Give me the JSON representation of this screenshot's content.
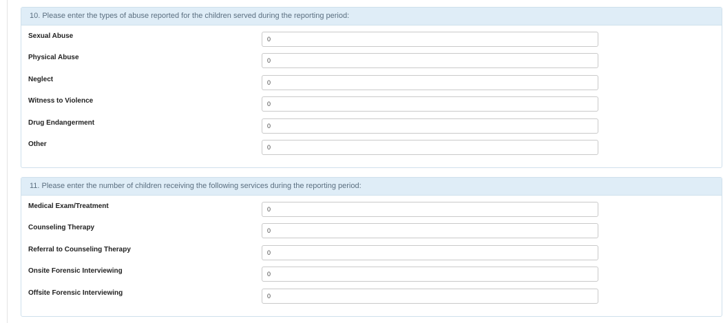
{
  "sections": [
    {
      "heading": "10. Please enter the types of abuse reported for the children served during the reporting period:",
      "rows": [
        {
          "label": "Sexual Abuse",
          "value": "0"
        },
        {
          "label": "Physical Abuse",
          "value": "0"
        },
        {
          "label": "Neglect",
          "value": "0"
        },
        {
          "label": "Witness to Violence",
          "value": "0"
        },
        {
          "label": "Drug Endangerment",
          "value": "0"
        },
        {
          "label": "Other",
          "value": "0"
        }
      ]
    },
    {
      "heading": "11. Please enter the number of children receiving the following services during the reporting period:",
      "rows": [
        {
          "label": "Medical Exam/Treatment",
          "value": "0"
        },
        {
          "label": "Counseling Therapy",
          "value": "0"
        },
        {
          "label": "Referral to Counseling Therapy",
          "value": "0"
        },
        {
          "label": "Onsite Forensic Interviewing",
          "value": "0"
        },
        {
          "label": "Offsite Forensic Interviewing",
          "value": "0"
        }
      ]
    }
  ]
}
